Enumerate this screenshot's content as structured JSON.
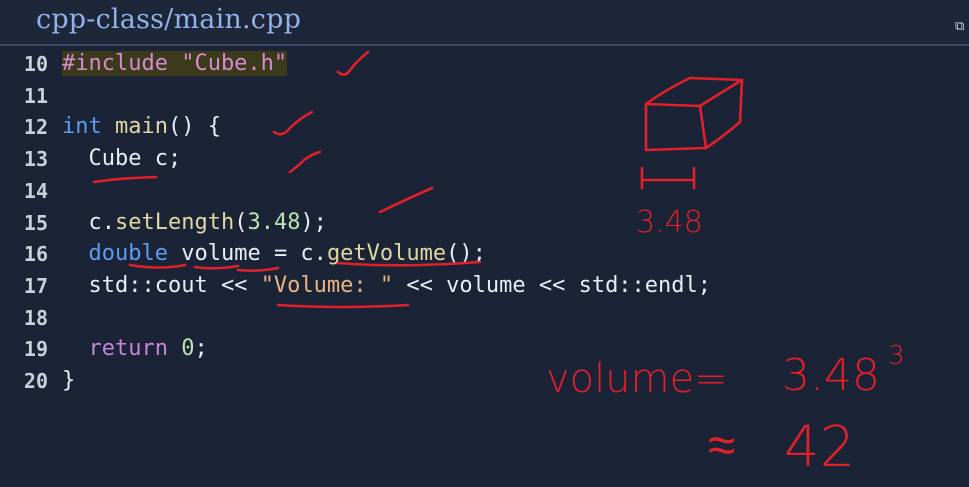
{
  "window": {
    "title": "cpp-class/main.cpp",
    "popout_icon": "external-link-icon"
  },
  "code": {
    "lines": [
      {
        "n": "10",
        "tokens": [
          {
            "t": "#include \"Cube.h\"",
            "c": "str-hl"
          }
        ]
      },
      {
        "n": "11",
        "tokens": []
      },
      {
        "n": "12",
        "tokens": [
          {
            "t": "int",
            "c": "kw"
          },
          {
            "t": " "
          },
          {
            "t": "main",
            "c": "fn"
          },
          {
            "t": "() {"
          }
        ]
      },
      {
        "n": "13",
        "tokens": [
          {
            "t": "  Cube",
            "c": "plain"
          },
          {
            "t": " c;"
          }
        ]
      },
      {
        "n": "14",
        "tokens": []
      },
      {
        "n": "15",
        "tokens": [
          {
            "t": "  c."
          },
          {
            "t": "setLength",
            "c": "fn"
          },
          {
            "t": "("
          },
          {
            "t": "3.48",
            "c": "num"
          },
          {
            "t": ");"
          }
        ]
      },
      {
        "n": "16",
        "tokens": [
          {
            "t": "  "
          },
          {
            "t": "double",
            "c": "kw"
          },
          {
            "t": " volume = c."
          },
          {
            "t": "getVolume",
            "c": "fn"
          },
          {
            "t": "();"
          }
        ]
      },
      {
        "n": "17",
        "tokens": [
          {
            "t": "  std::cout << "
          },
          {
            "t": "\"Volume: \"",
            "c": "str"
          },
          {
            "t": " << volume << std::endl;"
          }
        ]
      },
      {
        "n": "18",
        "tokens": []
      },
      {
        "n": "19",
        "tokens": [
          {
            "t": "  "
          },
          {
            "t": "return",
            "c": "kw2"
          },
          {
            "t": " "
          },
          {
            "t": "0",
            "c": "num"
          },
          {
            "t": ";"
          }
        ]
      },
      {
        "n": "20",
        "tokens": [
          {
            "t": "}"
          }
        ]
      }
    ]
  },
  "annotations": {
    "ink_color": "#e0202a",
    "cube_label": "3.48",
    "volume_label": "volume=",
    "volume_expr": "3.48",
    "exponent": "3",
    "approx": "≈",
    "approx_value": "42"
  }
}
